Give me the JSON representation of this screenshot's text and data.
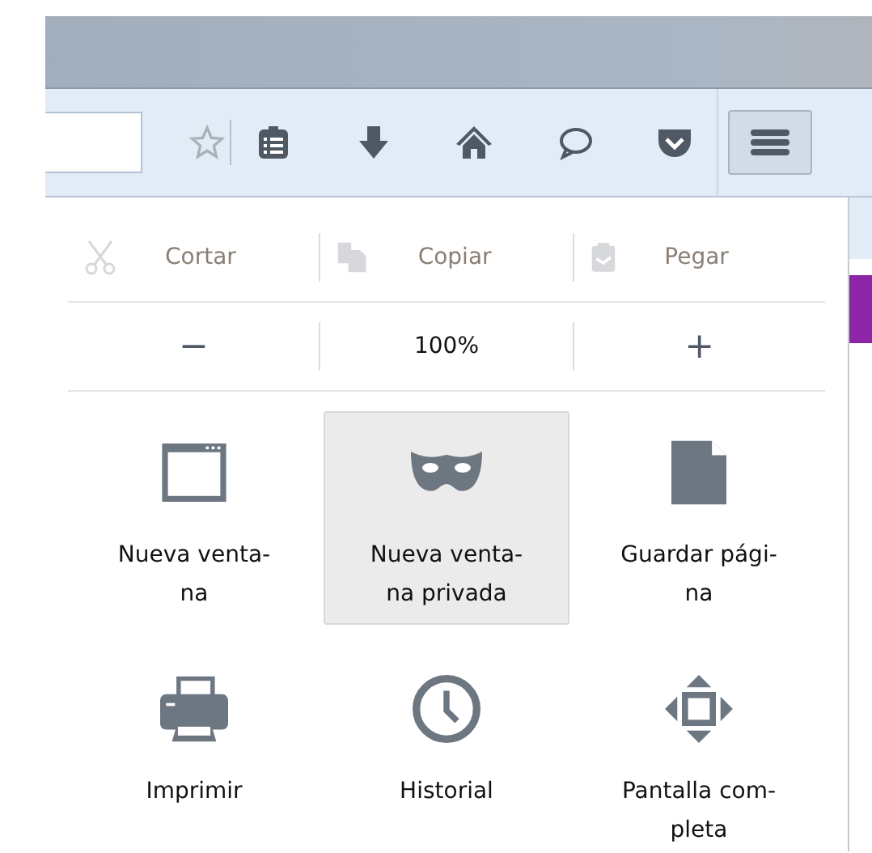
{
  "toolbar": {
    "buttons": [
      {
        "kind": "star",
        "selected": false
      },
      {
        "kind": "reading-list",
        "selected": false
      },
      {
        "kind": "download",
        "selected": false
      },
      {
        "kind": "home",
        "selected": false
      },
      {
        "kind": "chat",
        "selected": false
      },
      {
        "kind": "pocket",
        "selected": false
      },
      {
        "kind": "menu",
        "selected": true
      }
    ]
  },
  "menu_panel": {
    "edit_row": [
      {
        "kind": "cut",
        "label": "Cortar",
        "disabled": true
      },
      {
        "kind": "copy",
        "label": "Copiar",
        "disabled": true
      },
      {
        "kind": "paste",
        "label": "Pegar",
        "disabled": true
      }
    ],
    "zoom_row": {
      "minus": "−",
      "level": "100%",
      "plus": "+"
    },
    "items": [
      {
        "kind": "window",
        "label": "Nueva venta-\nna",
        "selected": false
      },
      {
        "kind": "mask",
        "label": "Nueva venta-\nna privada",
        "selected": true
      },
      {
        "kind": "page",
        "label": "Guardar pági-\nna",
        "selected": false
      },
      {
        "kind": "printer",
        "label": "Imprimir",
        "selected": false
      },
      {
        "kind": "clock",
        "label": "Historial",
        "selected": false
      },
      {
        "kind": "fullscreen",
        "label": "Pantalla com-\npleta",
        "selected": false
      }
    ]
  }
}
